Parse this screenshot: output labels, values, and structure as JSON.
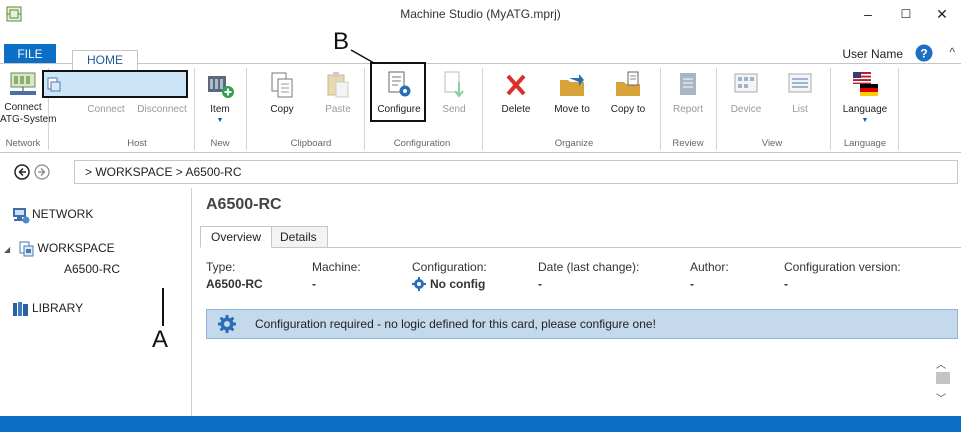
{
  "window": {
    "title": "Machine Studio (MyATG.mprj)",
    "minimize": "–",
    "maximize": "☐",
    "close": "✕"
  },
  "menu": {
    "file": "FILE",
    "home": "HOME",
    "user": "User Name",
    "help_icon": "help-icon",
    "collapse": "^"
  },
  "ribbon": {
    "groups": {
      "network": "Network",
      "host": "Host",
      "new": "New",
      "clipboard": "Clipboard",
      "configuration": "Configuration",
      "organize": "Organize",
      "review": "Review",
      "view": "View",
      "language": "Language"
    },
    "buttons": {
      "connect_atg_line1": "Connect",
      "connect_atg_line2": "ATG-System",
      "connect": "Connect",
      "disconnect": "Disconnect",
      "item": "Item",
      "copy": "Copy",
      "paste": "Paste",
      "configure": "Configure",
      "send": "Send",
      "delete": "Delete",
      "move_to": "Move to",
      "copy_to": "Copy to",
      "report": "Report",
      "device": "Device",
      "list": "List",
      "language": "Language"
    }
  },
  "callouts": {
    "a": "A",
    "b": "B"
  },
  "navigation": {
    "breadcrumb": "> WORKSPACE > A6500-RC"
  },
  "tree": {
    "network": "NETWORK",
    "workspace": "WORKSPACE",
    "selected": "A6500-RC",
    "library": "LIBRARY"
  },
  "main": {
    "title": "A6500-RC",
    "tabs": [
      "Overview",
      "Details"
    ],
    "fields": [
      {
        "label": "Type:",
        "value": "A6500-RC"
      },
      {
        "label": "Machine:",
        "value": "-"
      },
      {
        "label": "Configuration:",
        "value": "No config"
      },
      {
        "label": "Date (last change):",
        "value": "-"
      },
      {
        "label": "Author:",
        "value": "-"
      },
      {
        "label": "Configuration version:",
        "value": "-"
      }
    ],
    "config_message": "Configuration required - no logic defined for this card, please configure one!"
  },
  "colors": {
    "accent": "#0b6fc5",
    "selection": "#cce4f7",
    "config_bar": "#c4d9ec"
  }
}
